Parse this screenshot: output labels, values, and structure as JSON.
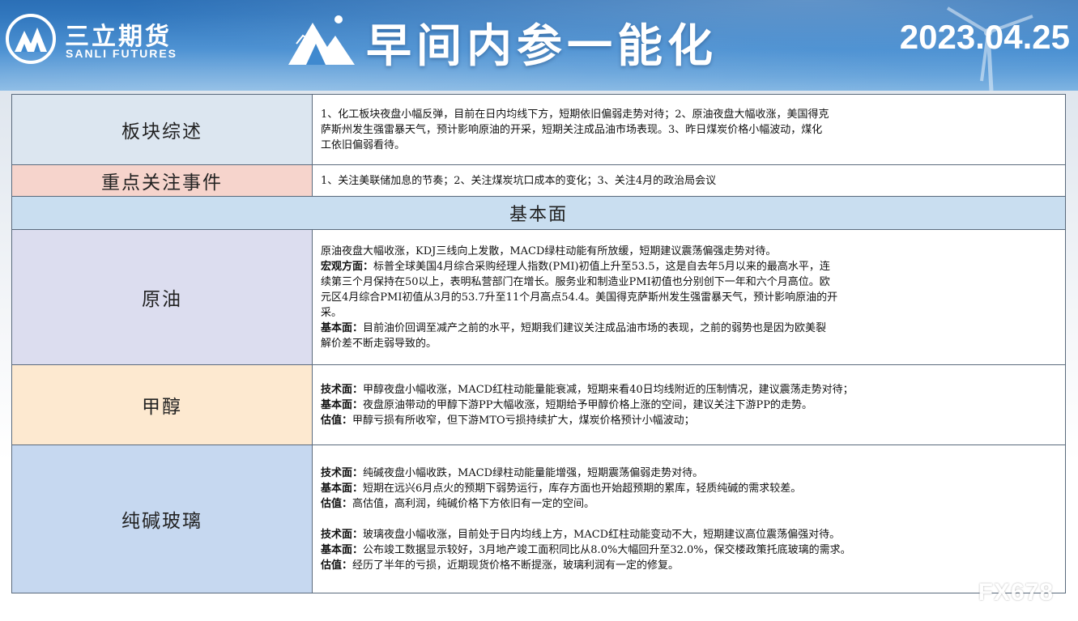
{
  "header": {
    "brand_cn": "三立期货",
    "brand_en": "SANLI FUTURES",
    "title": "早间内参一能化",
    "date": "2023.04.25"
  },
  "rows": {
    "overview": {
      "label": "板块综述",
      "lines": [
        "1、化工板块夜盘小幅反弹，目前在日内均线下方，短期依旧偏弱走势对待；2、原油夜盘大幅收涨，美国得克",
        "萨斯州发生强雷暴天气，预计影响原油的开采，短期关注成品油市场表现。3、昨日煤炭价格小幅波动，煤化",
        "工依旧偏弱看待。"
      ]
    },
    "events": {
      "label": "重点关注事件",
      "text": "1、关注美联储加息的节奏；2、关注煤炭坑口成本的变化；3、关注4月的政治局会议"
    },
    "section_title": "基本面",
    "crude": {
      "label": "原油",
      "intro": "原油夜盘大幅收涨，KDJ三线向上发散，MACD绿柱动能有所放缓，短期建议震荡偏强走势对待。",
      "macro_label": "宏观方面：",
      "macro_lines": [
        "标普全球美国4月综合采购经理人指数(PMI)初值上升至53.5，这是自去年5月以来的最高水平，连",
        "续第三个月保持在50以上，表明私营部门在增长。服务业和制造业PMI初值也分别创下一年和六个月高位。欧",
        "元区4月综合PMI初值从3月的53.7升至11个月高点54.4。美国得克萨斯州发生强雷暴天气，预计影响原油的开",
        "采。"
      ],
      "fund_label": "基本面：",
      "fund_lines": [
        "目前油价回调至减产之前的水平，短期我们建议关注成品油市场的表现，之前的弱势也是因为欧美裂",
        "解价差不断走弱导致的。"
      ]
    },
    "methanol": {
      "label": "甲醇",
      "tech_label": "技术面：",
      "tech": "甲醇夜盘小幅收涨，MACD红柱动能量能衰减，短期来看40日均线附近的压制情况，建议震荡走势对待；",
      "fund_label": "基本面：",
      "fund": "夜盘原油带动的甲醇下游PP大幅收涨，短期给予甲醇价格上涨的空间，建议关注下游PP的走势。",
      "val_label": "估值：",
      "val": "甲醇亏损有所收窄，但下游MTO亏损持续扩大，煤炭价格预计小幅波动；"
    },
    "soda_glass": {
      "label": "纯碱玻璃",
      "soda_tech_label": "技术面：",
      "soda_tech": "纯碱夜盘小幅收跌，MACD绿柱动能量能增强，短期震荡偏弱走势对待。",
      "soda_fund_label": "基本面：",
      "soda_fund": "短期在远兴6月点火的预期下弱势运行，库存方面也开始超预期的累库，轻质纯碱的需求较差。",
      "soda_val_label": "估值：",
      "soda_val": "高估值，高利润，纯碱价格下方依旧有一定的空间。",
      "glass_tech_label": "技术面：",
      "glass_tech": "玻璃夜盘小幅收涨，目前处于日内均线上方，MACD红柱动能变动不大，短期建议高位震荡偏强对待。",
      "glass_fund_label": "基本面：",
      "glass_fund": "公布竣工数据显示较好，3月地产竣工面积同比从8.0%大幅回升至32.0%，保交楼政策托底玻璃的需求。",
      "glass_val_label": "估值：",
      "glass_val": "经历了半年的亏损，近期现货价格不断提涨，玻璃利润有一定的修复。"
    }
  },
  "watermark": "FX678",
  "colors": {
    "banner": "#3f89cf",
    "overview_label_bg": "#dce6f0",
    "events_label_bg": "#f6d4cc",
    "section_bg": "#c9def0",
    "crude_label_bg": "#dcddef",
    "methanol_label_bg": "#fde9d0",
    "soda_label_bg": "#c6d8f0"
  }
}
